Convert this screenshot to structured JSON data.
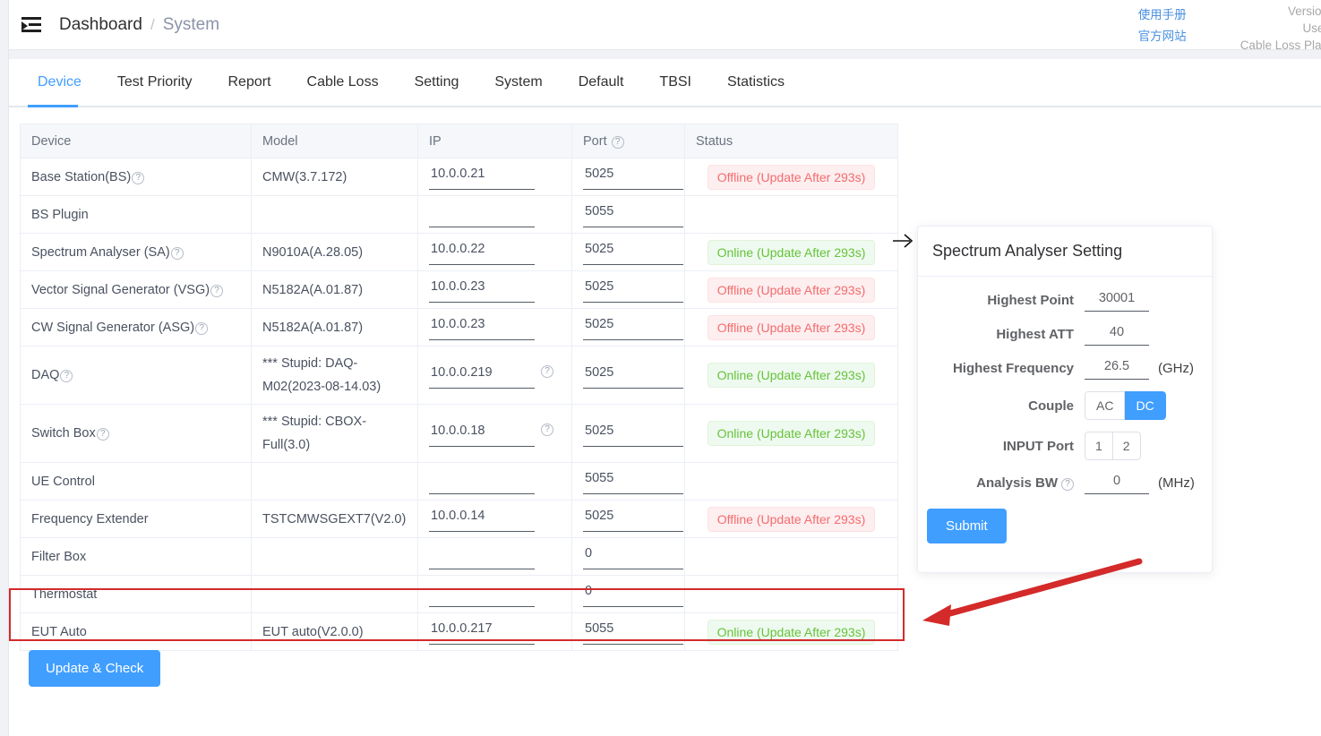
{
  "header": {
    "menu_icon": "menu-fold-icon",
    "breadcrumb_root": "Dashboard",
    "breadcrumb_sep": "/",
    "breadcrumb_current": "System",
    "links": [
      {
        "label": "使用手册",
        "name": "user-manual-link"
      },
      {
        "label": "官方网站",
        "name": "official-website-link"
      }
    ],
    "meta": [
      {
        "label": "Version"
      },
      {
        "label": "User"
      },
      {
        "label": "Cable Loss Plan"
      }
    ]
  },
  "tabs": [
    {
      "label": "Device",
      "active": true
    },
    {
      "label": "Test Priority",
      "active": false
    },
    {
      "label": "Report",
      "active": false
    },
    {
      "label": "Cable Loss",
      "active": false
    },
    {
      "label": "Setting",
      "active": false
    },
    {
      "label": "System",
      "active": false
    },
    {
      "label": "Default",
      "active": false
    },
    {
      "label": "TBSI",
      "active": false
    },
    {
      "label": "Statistics",
      "active": false
    }
  ],
  "table": {
    "columns": [
      "Device",
      "Model",
      "IP",
      "Port",
      "Status"
    ],
    "port_help_icon": "question-mark-icon",
    "rows": [
      {
        "device": "Base Station(BS)",
        "device_help": true,
        "model": "CMW(3.7.172)",
        "ip": "10.0.0.21",
        "ip_help": false,
        "port": "5025",
        "status": "Offline (Update After 293s)",
        "status_kind": "offline"
      },
      {
        "device": "BS Plugin",
        "device_help": false,
        "model": "",
        "ip": "",
        "ip_help": false,
        "port": "5055",
        "status": "",
        "status_kind": "none"
      },
      {
        "device": "Spectrum Analyser (SA)",
        "device_help": true,
        "model": "N9010A(A.28.05)",
        "ip": "10.0.0.22",
        "ip_help": false,
        "port": "5025",
        "status": "Online (Update After 293s)",
        "status_kind": "online"
      },
      {
        "device": "Vector Signal Generator (VSG)",
        "device_help": true,
        "model": "N5182A(A.01.87)",
        "ip": "10.0.0.23",
        "ip_help": false,
        "port": "5025",
        "status": "Offline (Update After 293s)",
        "status_kind": "offline"
      },
      {
        "device": "CW Signal Generator (ASG)",
        "device_help": true,
        "model": "N5182A(A.01.87)",
        "ip": "10.0.0.23",
        "ip_help": false,
        "port": "5025",
        "status": "Offline (Update After 293s)",
        "status_kind": "offline"
      },
      {
        "device": "DAQ",
        "device_help": true,
        "model": "*** Stupid: DAQ-M02(2023-08-14.03)",
        "ip": "10.0.0.219",
        "ip_help": true,
        "port": "5025",
        "status": "Online (Update After 293s)",
        "status_kind": "online"
      },
      {
        "device": "Switch Box",
        "device_help": true,
        "model": "*** Stupid: CBOX-Full(3.0)",
        "ip": "10.0.0.18",
        "ip_help": true,
        "port": "5025",
        "status": "Online (Update After 293s)",
        "status_kind": "online"
      },
      {
        "device": "UE Control",
        "device_help": false,
        "model": "",
        "ip": "",
        "ip_help": false,
        "port": "5055",
        "status": "",
        "status_kind": "none"
      },
      {
        "device": "Frequency Extender",
        "device_help": false,
        "model": "TSTCMWSGEXT7(V2.0)",
        "ip": "10.0.0.14",
        "ip_help": false,
        "port": "5025",
        "status": "Offline (Update After 293s)",
        "status_kind": "offline"
      },
      {
        "device": "Filter Box",
        "device_help": false,
        "model": "",
        "ip": "",
        "ip_help": false,
        "port": "0",
        "status": "",
        "status_kind": "none"
      },
      {
        "device": "Thermostat",
        "device_help": false,
        "model": "",
        "ip": "",
        "ip_help": false,
        "port": "0",
        "status": "",
        "status_kind": "none"
      },
      {
        "device": "EUT Auto",
        "device_help": false,
        "model": "EUT auto(V2.0.0)",
        "ip": "10.0.0.217",
        "ip_help": false,
        "port": "5055",
        "status": "Online (Update After 293s)",
        "status_kind": "online"
      }
    ],
    "update_button": "Update & Check"
  },
  "sa_panel": {
    "title": "Spectrum Analyser Setting",
    "fields": {
      "highest_point_label": "Highest Point",
      "highest_point_value": "30001",
      "highest_att_label": "Highest ATT",
      "highest_att_value": "40",
      "highest_frequency_label": "Highest Frequency",
      "highest_frequency_value": "26.5",
      "highest_frequency_unit": "(GHz)",
      "couple_label": "Couple",
      "couple_options": [
        "AC",
        "DC"
      ],
      "couple_selected": "DC",
      "input_port_label": "INPUT Port",
      "input_port_options": [
        "1",
        "2"
      ],
      "input_port_selected": "",
      "analysis_bw_label": "Analysis BW",
      "analysis_bw_value": "0",
      "analysis_bw_unit": "(MHz)"
    },
    "submit_label": "Submit"
  },
  "annotations": {
    "pointer_arrow_icon": "arrow-right-icon",
    "highlight_box_color": "#d42a2a",
    "callout_arrow_color": "#d42a2a"
  },
  "colors": {
    "accent": "#409eff",
    "online": "#67c23a",
    "offline": "#f56c6c",
    "annotation": "#d42a2a"
  }
}
